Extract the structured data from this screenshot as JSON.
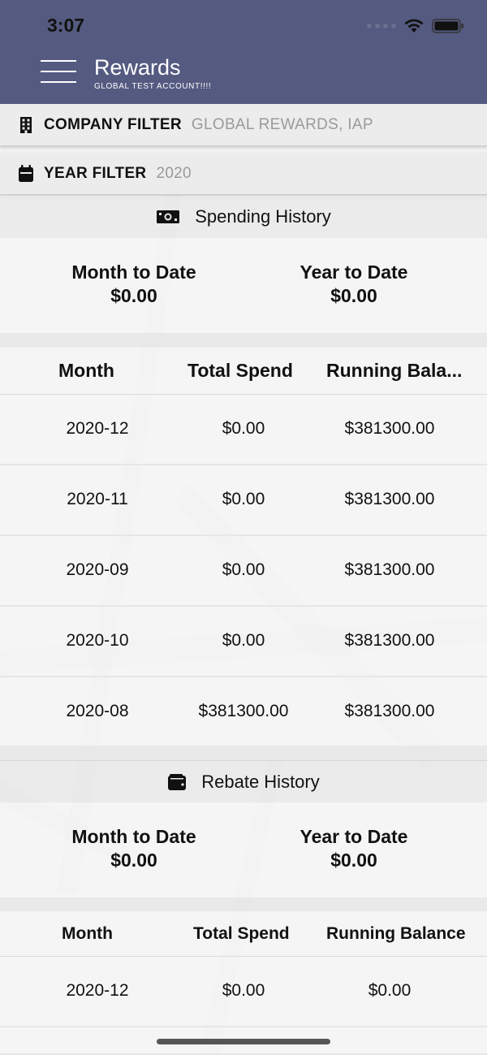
{
  "status_bar": {
    "time": "3:07"
  },
  "header": {
    "title": "Rewards",
    "subtitle": "GLOBAL TEST ACCOUNT!!!!"
  },
  "filters": {
    "company": {
      "label": "COMPANY FILTER",
      "value": "GLOBAL REWARDS, IAP"
    },
    "year": {
      "label": "YEAR FILTER",
      "value": "2020"
    }
  },
  "spending": {
    "title": "Spending History",
    "month_to_date_label": "Month to Date",
    "month_to_date_value": "$0.00",
    "year_to_date_label": "Year to Date",
    "year_to_date_value": "$0.00",
    "columns": [
      "Month",
      "Total Spend",
      "Running Bala..."
    ],
    "rows": [
      {
        "month": "2020-12",
        "total_spend": "$0.00",
        "running_balance": "$381300.00"
      },
      {
        "month": "2020-11",
        "total_spend": "$0.00",
        "running_balance": "$381300.00"
      },
      {
        "month": "2020-09",
        "total_spend": "$0.00",
        "running_balance": "$381300.00"
      },
      {
        "month": "2020-10",
        "total_spend": "$0.00",
        "running_balance": "$381300.00"
      },
      {
        "month": "2020-08",
        "total_spend": "$381300.00",
        "running_balance": "$381300.00"
      }
    ]
  },
  "rebate": {
    "title": "Rebate History",
    "month_to_date_label": "Month to Date",
    "month_to_date_value": "$0.00",
    "year_to_date_label": "Year to Date",
    "year_to_date_value": "$0.00",
    "columns": [
      "Month",
      "Total Spend",
      "Running Balance"
    ],
    "rows": [
      {
        "month": "2020-12",
        "total_spend": "$0.00",
        "running_balance": "$0.00"
      }
    ]
  },
  "colors": {
    "header_bg": "#545a80",
    "page_bg": "#f2f2f2"
  }
}
